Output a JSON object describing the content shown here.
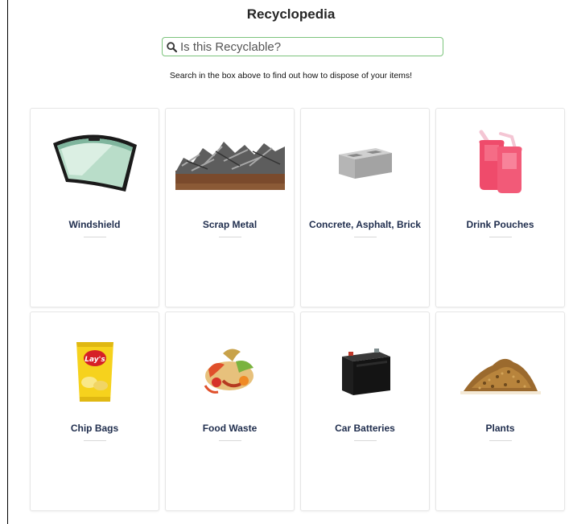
{
  "header": {
    "title": "Recyclopedia"
  },
  "search": {
    "placeholder": "Is this Recyclable?",
    "icon": "search-icon"
  },
  "subtitle": "Search in the box above to find out how to dispose of your items!",
  "items": [
    {
      "label": "Windshield",
      "icon": "windshield-image"
    },
    {
      "label": "Scrap Metal",
      "icon": "scrap-metal-image"
    },
    {
      "label": "Concrete, Asphalt, Brick",
      "icon": "concrete-block-image"
    },
    {
      "label": "Drink Pouches",
      "icon": "drink-pouches-image"
    },
    {
      "label": "Chip Bags",
      "icon": "chip-bag-image"
    },
    {
      "label": "Food Waste",
      "icon": "food-waste-image"
    },
    {
      "label": "Car Batteries",
      "icon": "car-battery-image"
    },
    {
      "label": "Plants",
      "icon": "plants-image"
    }
  ],
  "colors": {
    "label_text": "#1f2d4d",
    "search_border": "#7cc47c",
    "card_border": "#e6e6e6"
  }
}
